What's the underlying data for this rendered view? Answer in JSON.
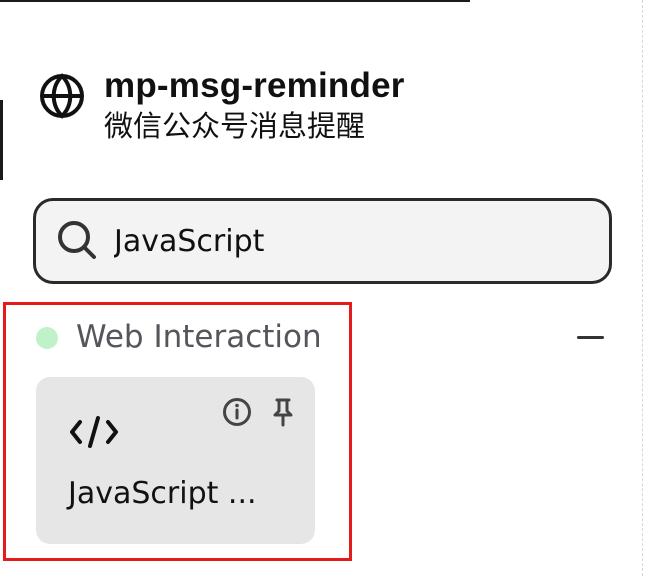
{
  "header": {
    "title": "mp-msg-reminder",
    "subtitle": "微信公众号消息提醒",
    "icon": "globe-icon"
  },
  "search": {
    "value": "JavaScript",
    "placeholder": "",
    "icon": "search-icon"
  },
  "section": {
    "label": "Web Interaction",
    "status_color": "#bff2c9",
    "collapse_icon": "minus-icon"
  },
  "card": {
    "title": "JavaScript ...",
    "icon": "code-icon",
    "action_icons": [
      "info-icon",
      "pin-icon"
    ]
  },
  "colors": {
    "highlight": "#e31b1b",
    "card_background": "#e6e6e6",
    "search_background": "#f3f3f3",
    "text": "#111111",
    "muted_text": "#55555c"
  }
}
